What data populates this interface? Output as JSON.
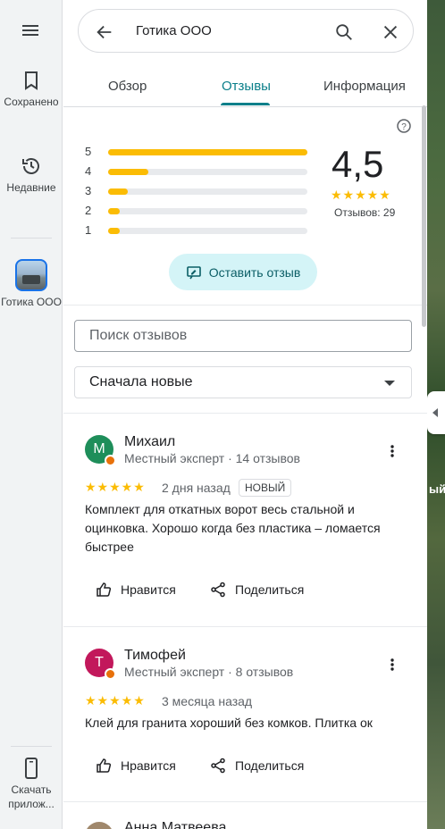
{
  "rail": {
    "saved_label": "Сохранено",
    "recent_label": "Недавние",
    "place_label": "Готика ООО",
    "download_label": "Скачать прилож..."
  },
  "search": {
    "query": "Готика ООО"
  },
  "tabs": [
    {
      "label": "Обзор"
    },
    {
      "label": "Отзывы"
    },
    {
      "label": "Информация"
    }
  ],
  "rating": {
    "value": "4,5",
    "stars": "★★★★★",
    "count_text": "Отзывов: 29",
    "distribution": [
      {
        "star": "5",
        "fraction": 1.0
      },
      {
        "star": "4",
        "fraction": 0.2
      },
      {
        "star": "3",
        "fraction": 0.1
      },
      {
        "star": "2",
        "fraction": 0.06
      },
      {
        "star": "1",
        "fraction": 0.06
      }
    ]
  },
  "write_review_label": "Оставить отзыв",
  "review_search_placeholder": "Поиск отзывов",
  "sort_label": "Сначала новые",
  "map_label": "ый",
  "reviews": [
    {
      "initial": "M",
      "color": "#1e8e5a",
      "name": "Михаил",
      "meta": "Местный эксперт · 14 отзывов",
      "stars": "★★★★★",
      "date": "2 дня назад",
      "badge": "НОВЫЙ",
      "text": "Комплект для откатных ворот весь стальной и оцинковка. Хорошо когда без пластика – ломается быстрее",
      "like_label": "Нравится",
      "share_label": "Поделиться"
    },
    {
      "initial": "Т",
      "color": "#c2185b",
      "name": "Тимофей",
      "meta": "Местный эксперт · 8 отзывов",
      "stars": "★★★★★",
      "date": "3 месяца назад",
      "text": "Клей для гранита хороший без комков. Плитка ок",
      "like_label": "Нравится",
      "share_label": "Поделиться"
    }
  ],
  "next_reviewer_name": "Анна Матвеева"
}
